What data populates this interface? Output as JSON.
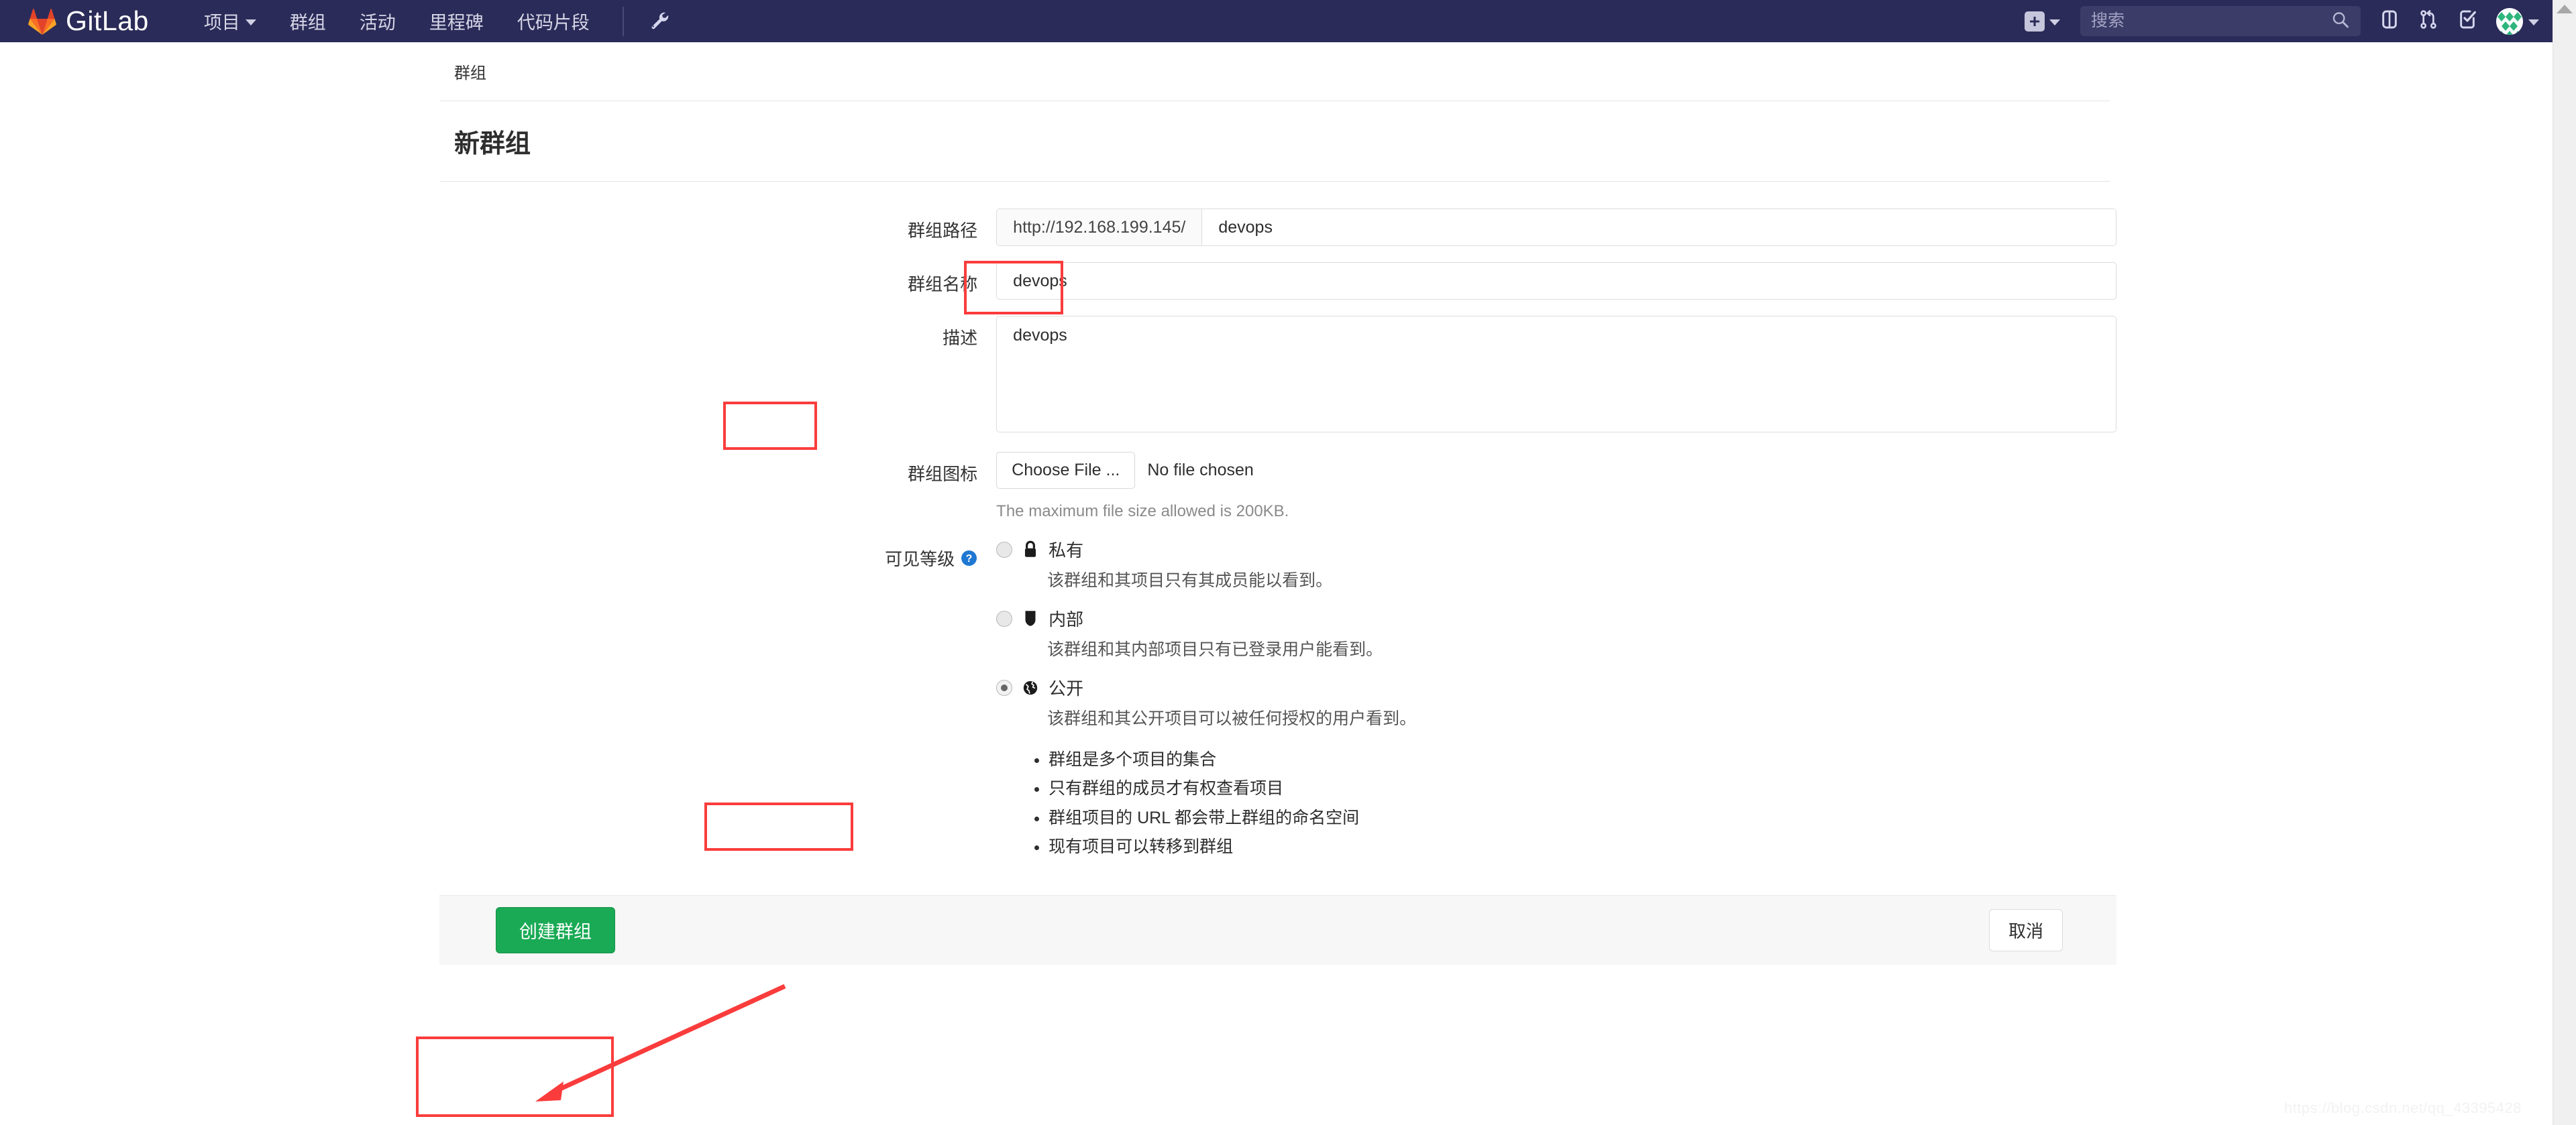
{
  "brand": {
    "name": "GitLab",
    "logo_icon": "gitlab-logo-icon"
  },
  "navbar": {
    "links": [
      {
        "label": "项目",
        "has_caret": true,
        "name": "nav-projects"
      },
      {
        "label": "群组",
        "has_caret": false,
        "name": "nav-groups"
      },
      {
        "label": "活动",
        "has_caret": false,
        "name": "nav-activity"
      },
      {
        "label": "里程碑",
        "has_caret": false,
        "name": "nav-milestones"
      },
      {
        "label": "代码片段",
        "has_caret": false,
        "name": "nav-snippets"
      }
    ],
    "admin_icon": "wrench-icon",
    "plus_label": "+",
    "icons": [
      "issues-icon",
      "merge-requests-icon",
      "todos-icon"
    ],
    "avatar_icon": "user-avatar"
  },
  "search": {
    "placeholder": "搜索",
    "value": "",
    "icon": "search-icon"
  },
  "breadcrumb": {
    "label": "群组"
  },
  "header": {
    "title": "新群组"
  },
  "form": {
    "path": {
      "label": "群组路径",
      "prefix": "http://192.168.199.145/",
      "value": "devops"
    },
    "name": {
      "label": "群组名称",
      "value": "devops"
    },
    "description": {
      "label": "描述",
      "value": "devops"
    },
    "avatar": {
      "label": "群组图标",
      "button": "Choose File ...",
      "file_status": "No file chosen",
      "hint": "The maximum file size allowed is 200KB."
    },
    "visibility": {
      "label": "可见等级",
      "help_icon": "help-circle-icon",
      "options": [
        {
          "key": "private",
          "icon": "lock-icon",
          "label": "私有",
          "desc": "该群组和其项目只有其成员能以看到。",
          "selected": false
        },
        {
          "key": "internal",
          "icon": "shield-icon",
          "label": "内部",
          "desc": "该群组和其内部项目只有已登录用户能看到。",
          "selected": false
        },
        {
          "key": "public",
          "icon": "globe-icon",
          "label": "公开",
          "desc": "该群组和其公开项目可以被任何授权的用户看到。",
          "selected": true
        }
      ],
      "bullets": [
        "群组是多个项目的集合",
        "只有群组的成员才有权查看项目",
        "群组项目的 URL 都会带上群组的命名空间",
        "现有项目可以转移到群组"
      ]
    }
  },
  "actions": {
    "submit_label": "创建群组",
    "cancel_label": "取消"
  },
  "watermark": {
    "text": "https://blog.csdn.net/qq_43395428"
  },
  "colors": {
    "navbar_bg": "#2b2b59",
    "submit_green": "#1aaa55",
    "annotation_red": "#fa3c3c",
    "help_blue": "#1f78d1"
  }
}
